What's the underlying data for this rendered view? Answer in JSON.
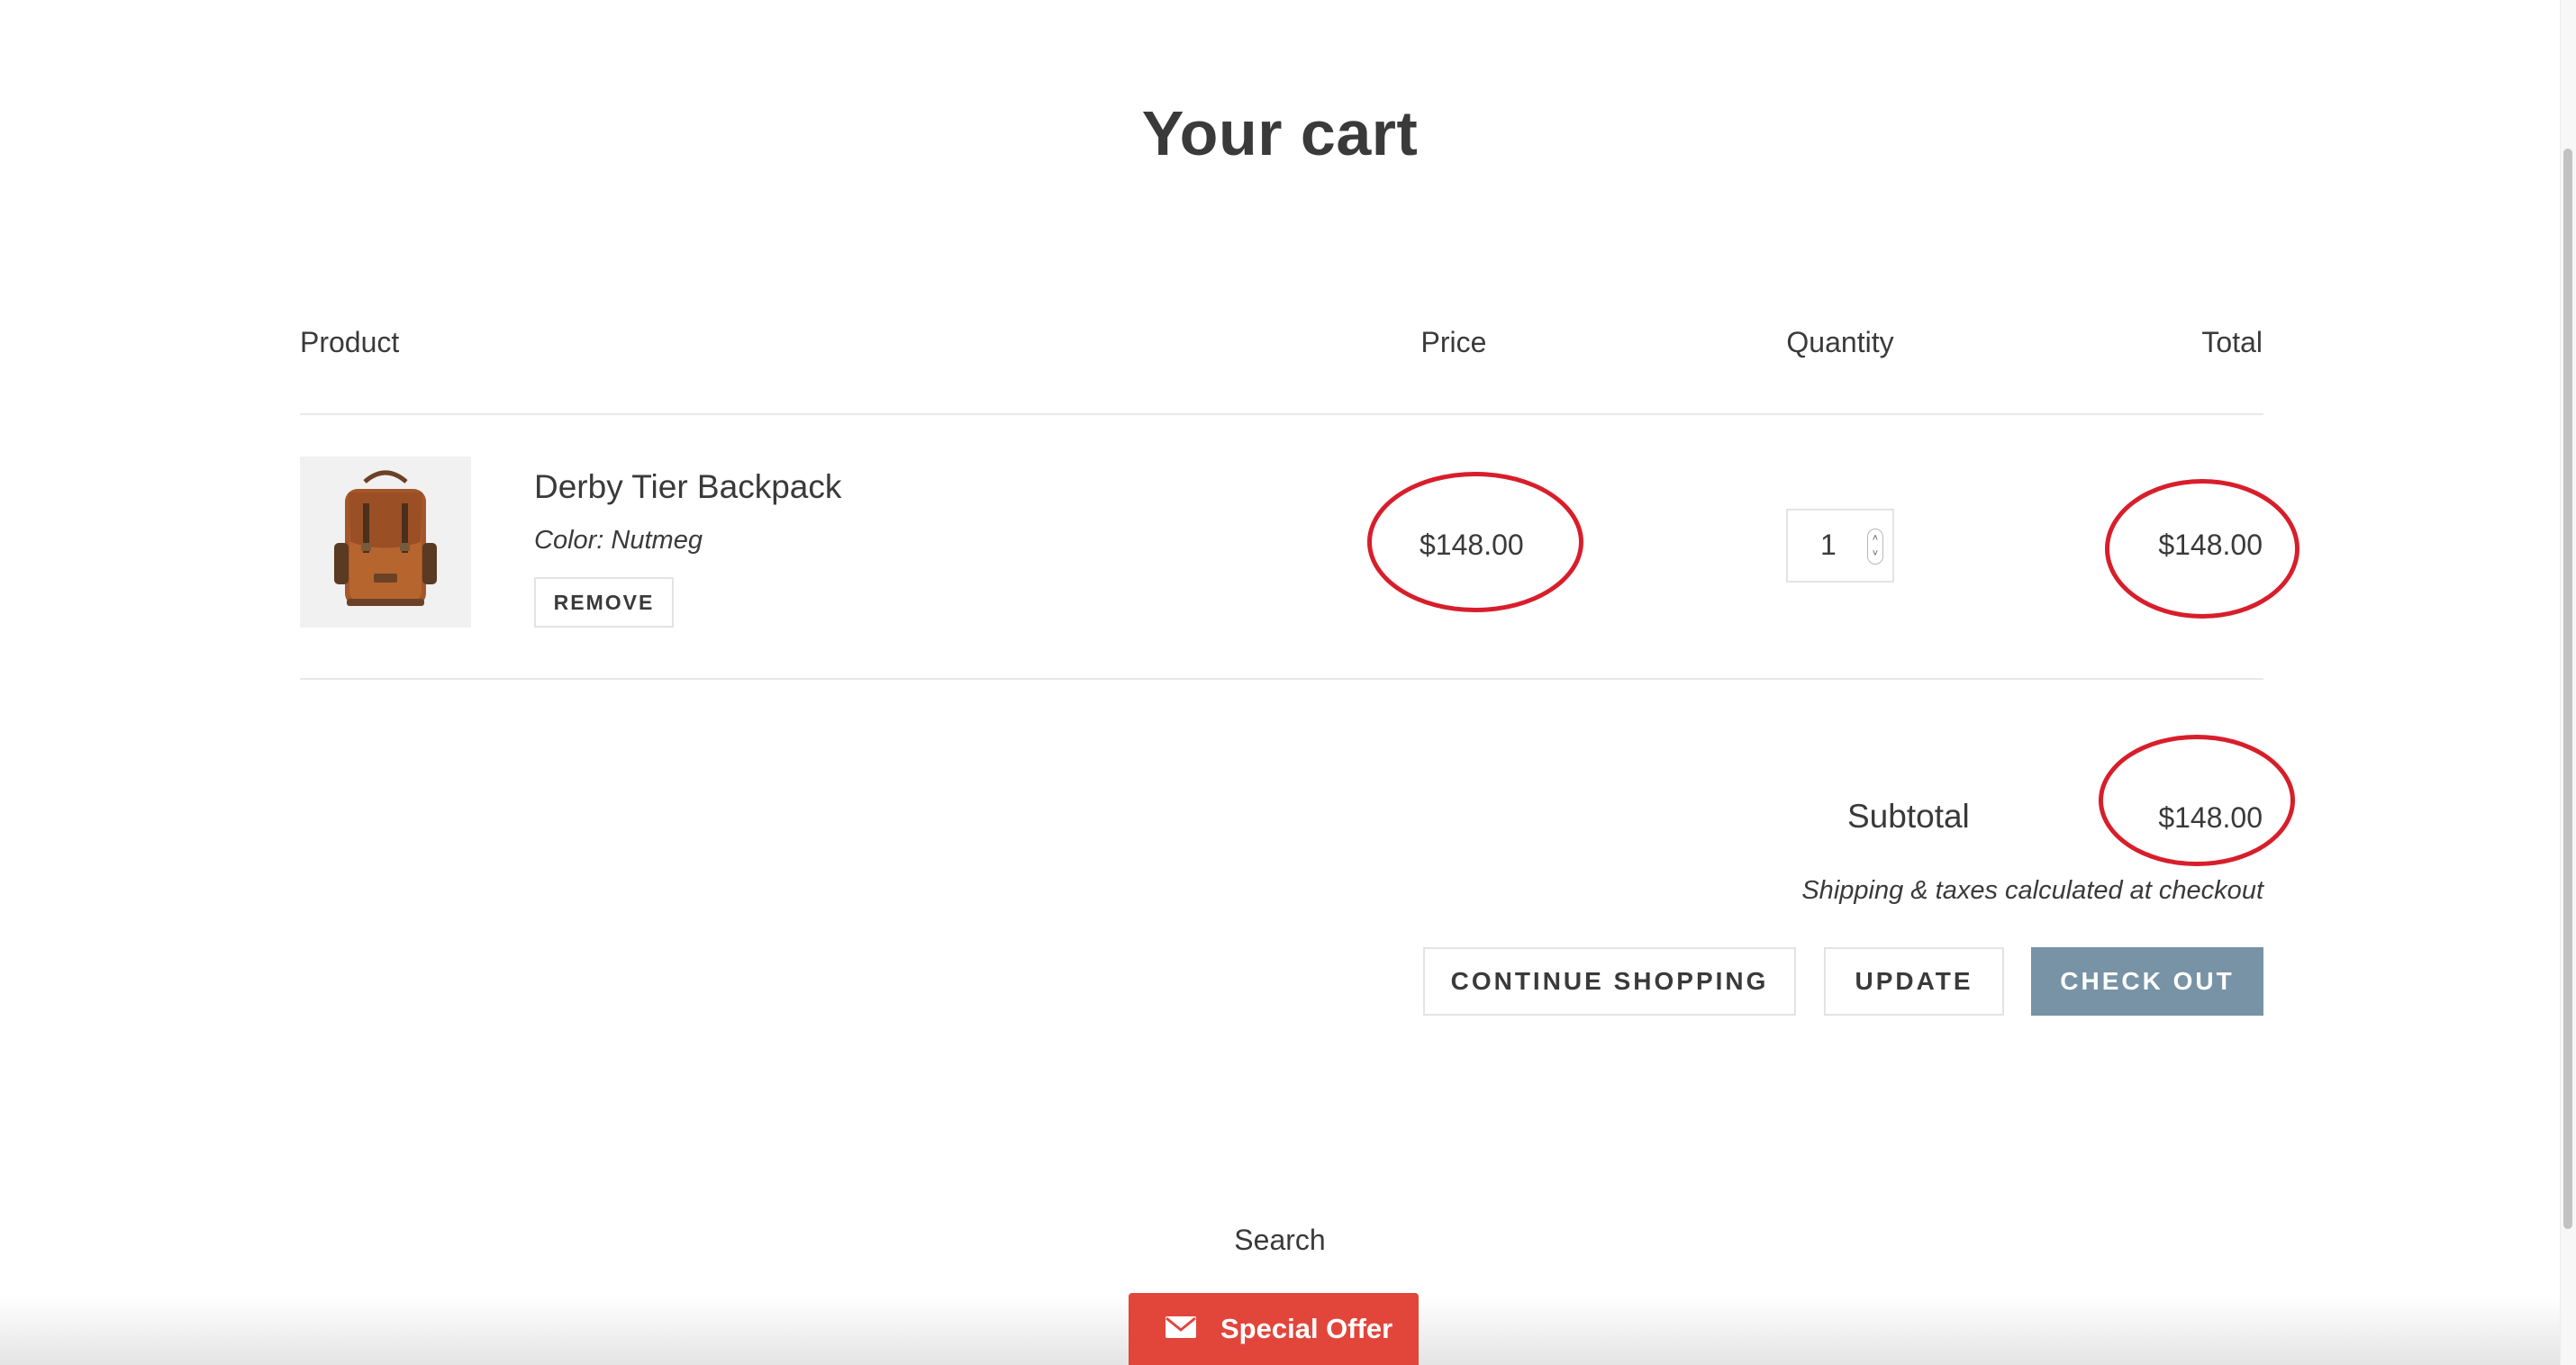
{
  "page": {
    "title": "Your cart"
  },
  "cart": {
    "headers": {
      "product": "Product",
      "price": "Price",
      "quantity": "Quantity",
      "total": "Total"
    },
    "items": [
      {
        "name": "Derby Tier Backpack",
        "variant": "Color: Nutmeg",
        "remove_label": "REMOVE",
        "price": "$148.00",
        "quantity": "1",
        "total": "$148.00",
        "image_icon": "backpack-image"
      }
    ],
    "subtotal_label": "Subtotal",
    "subtotal_value": "$148.00",
    "shipping_note": "Shipping & taxes calculated at checkout",
    "buttons": {
      "continue": "CONTINUE SHOPPING",
      "update": "UPDATE",
      "checkout": "CHECK OUT"
    }
  },
  "footer": {
    "search_link": "Search",
    "special_offer": "Special Offer",
    "special_offer_icon": "mail-icon"
  },
  "colors": {
    "text": "#3a3a3a",
    "checkout_button": "#7793a5",
    "annotation_circle": "#d81e2b",
    "special_offer": "#e2463b"
  }
}
